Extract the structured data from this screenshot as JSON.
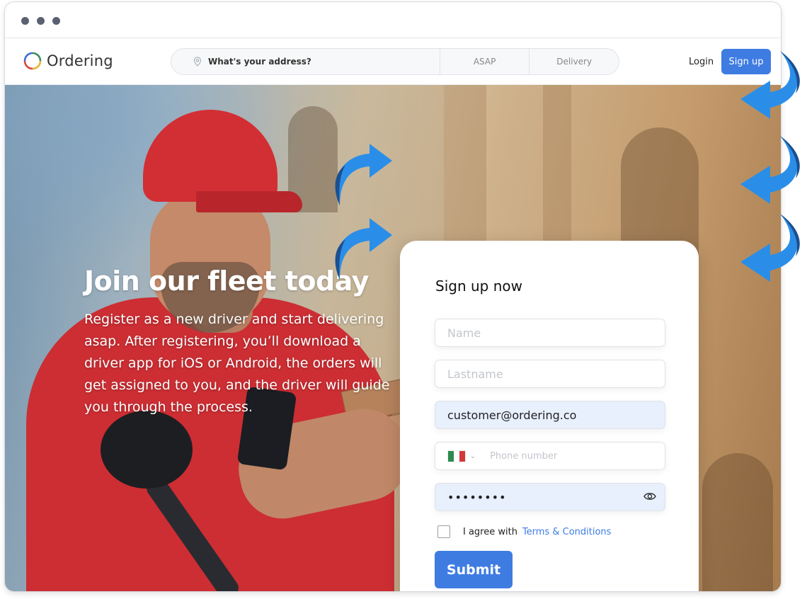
{
  "browser": {
    "window_dots": [
      "close-dot",
      "minimize-dot",
      "maximize-dot"
    ]
  },
  "navbar": {
    "logo_text": "Ordering",
    "address_placeholder": "What's your address?",
    "time_option": "ASAP",
    "order_type": "Delivery",
    "login_label": "Login",
    "signup_label": "Sign up"
  },
  "hero": {
    "title": "Join our fleet today",
    "description": "Register as a new driver and start delivering asap. After registering, you’ll download a driver app for iOS or Android, the orders will get assigned to you, and the driver will guide you through the process."
  },
  "form": {
    "title": "Sign up now",
    "name_placeholder": "Name",
    "lastname_placeholder": "Lastname",
    "email_value": "customer@ordering.co",
    "phone_placeholder": "Phone number",
    "country_flag": "mexico-flag",
    "password_value": "••••••••",
    "agree_text": "I agree with",
    "terms_link": "Terms & Conditions",
    "submit_label": "Submit"
  },
  "colors": {
    "accent": "#3e7ce2",
    "arrow": "#2a8ee8",
    "arrow_dark": "#1c4f8f"
  },
  "icons": [
    "location-pin-icon",
    "eye-icon",
    "chevron-down-icon",
    "curved-arrow-icon"
  ]
}
